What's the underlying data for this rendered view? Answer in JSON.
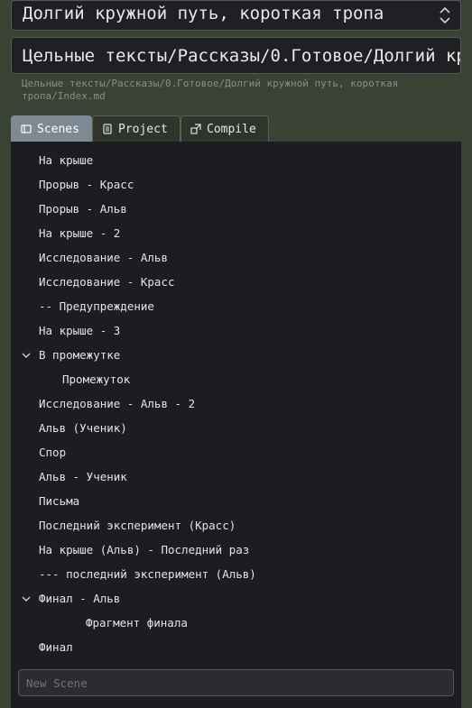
{
  "project": {
    "title": "Долгий кружной путь, короткая тропа"
  },
  "path": {
    "value": "Цельные тексты/Рассказы/0.Готовое/Долгий кружной путь, короткая тропа/Index.md",
    "hint": "Цельные тексты/Рассказы/0.Готовое/Долгий кружной путь, короткая тропа/Index.md"
  },
  "tabs": [
    {
      "label": "Scenes",
      "icon": "scenes-icon",
      "active": true
    },
    {
      "label": "Project",
      "icon": "document-icon",
      "active": false
    },
    {
      "label": "Compile",
      "icon": "compile-icon",
      "active": false
    }
  ],
  "scenes": [
    {
      "label": "На крыше"
    },
    {
      "label": "Прорыв - Красс"
    },
    {
      "label": "Прорыв - Альв"
    },
    {
      "label": "На крыше - 2"
    },
    {
      "label": "Исследование - Альв"
    },
    {
      "label": "Исследование - Красс"
    },
    {
      "label": "-- Предупреждение"
    },
    {
      "label": "На крыше - 3"
    },
    {
      "label": "В промежутке",
      "expanded": true
    },
    {
      "label": "Промежуток"
    },
    {
      "label": "Исследование - Альв - 2"
    },
    {
      "label": "Альв (Ученик)"
    },
    {
      "label": "Спор"
    },
    {
      "label": "Альв - Ученик"
    },
    {
      "label": "Письма"
    },
    {
      "label": "Последний эксперимент (Красс)"
    },
    {
      "label": "На крыше (Альв) - Последний раз"
    },
    {
      "label": "--- последний эксперимент (Альв)"
    },
    {
      "label": "Финал - Альв",
      "expanded": true
    },
    {
      "label": "Фрагмент финала"
    },
    {
      "label": "Финал"
    }
  ],
  "new_scene": {
    "placeholder": "New Scene",
    "value": ""
  }
}
